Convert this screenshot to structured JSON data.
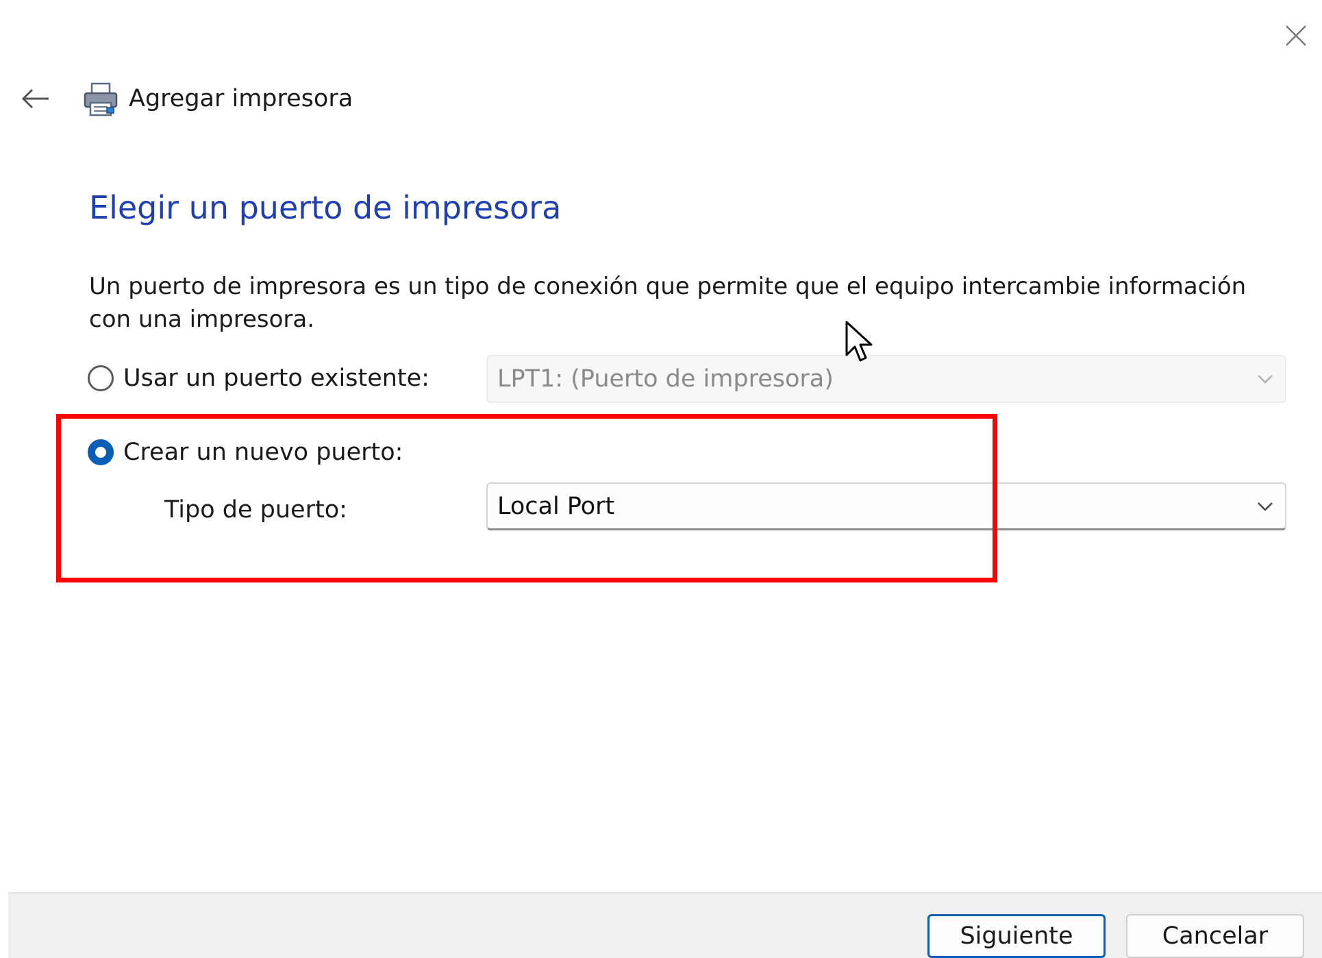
{
  "header": {
    "title": "Agregar impresora",
    "back_icon": "arrow-left-icon",
    "printer_icon": "printer-icon",
    "close_icon": "close-icon"
  },
  "main": {
    "heading": "Elegir un puerto de impresora",
    "description": "Un puerto de impresora es un tipo de conexión que permite que el equipo intercambie información con una impresora.",
    "existing_port": {
      "label": "Usar un puerto existente:",
      "selected": false,
      "combo_value": "LPT1: (Puerto de impresora)",
      "enabled": false
    },
    "new_port": {
      "label": "Crear un nuevo puerto:",
      "selected": true,
      "type_label": "Tipo de puerto:",
      "combo_value": "Local Port"
    }
  },
  "footer": {
    "next_label": "Siguiente",
    "cancel_label": "Cancelar"
  },
  "colors": {
    "heading": "#1f3fb0",
    "accent": "#0a5fb4",
    "highlight": "#ff0000"
  }
}
